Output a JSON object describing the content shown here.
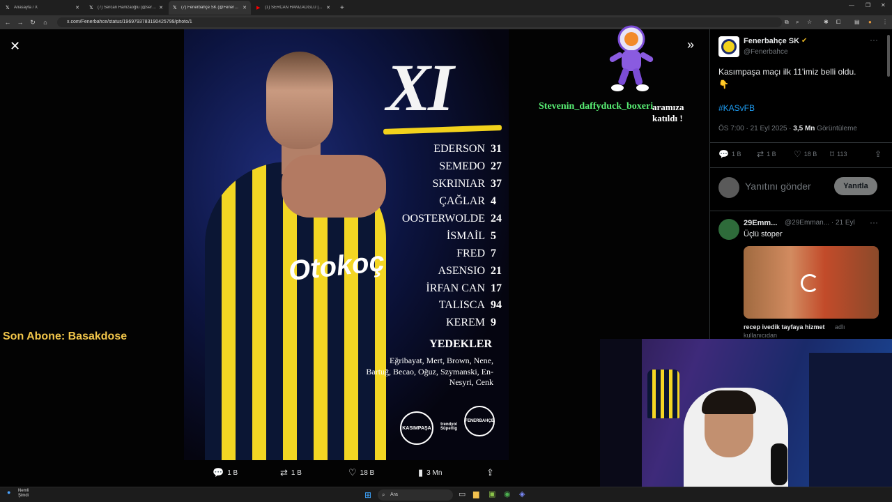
{
  "tabs": [
    {
      "title": "Anasayfa / X",
      "favicon": "x-icon",
      "active": false
    },
    {
      "title": "(7) Sercan Hamzaoğlu (@sercan",
      "favicon": "x-icon",
      "active": false
    },
    {
      "title": "(7) Fenerbahçe SK (@Fenerbah",
      "favicon": "x-icon",
      "active": true
    },
    {
      "title": "(1) SERCAN HAMZAOĞLU | FB",
      "favicon": "youtube-icon",
      "active": false
    }
  ],
  "address": {
    "url": "x.com/Fenerbahce/status/1969793783190425799/photo/1"
  },
  "photo": {
    "sponsor": "Otokoç",
    "title": "XI",
    "lineup": [
      {
        "name": "EDERSON",
        "number": "31"
      },
      {
        "name": "SEMEDO",
        "number": "27"
      },
      {
        "name": "SKRINIAR",
        "number": "37"
      },
      {
        "name": "ÇAĞLAR",
        "number": "4"
      },
      {
        "name": "OOSTERWOLDE",
        "number": "24"
      },
      {
        "name": "İSMAİL",
        "number": "5"
      },
      {
        "name": "FRED",
        "number": "7"
      },
      {
        "name": "ASENSIO",
        "number": "21"
      },
      {
        "name": "İRFAN CAN",
        "number": "17"
      },
      {
        "name": "TALISCA",
        "number": "94"
      },
      {
        "name": "KEREM",
        "number": "9"
      }
    ],
    "subs_title": "YEDEKLER",
    "subs_list": "Eğribayat, Mert, Brown, Nene, Bartuğ, Becao, Oğuz, Szymanski, En-Nesyri, Cenk",
    "logos": {
      "left": "KASIMPAŞA",
      "middle_line1": "trendyol",
      "middle_line2": "Süperlig",
      "right": "FENERBAHÇE"
    }
  },
  "overlay": {
    "username": "Stevenin_daffyduck_boxeri",
    "joined_text": "aramıza katıldı !",
    "son_abone": "Son Abone: Basakdose"
  },
  "photo_actions": {
    "replies": "1 B",
    "reposts": "1 B",
    "likes": "18 B",
    "views": "3 Mn"
  },
  "tweet": {
    "account_name": "Fenerbahçe SK",
    "handle": "@Fenerbahce",
    "text": "Kasımpaşa maçı ilk 11'imiz belli oldu.",
    "emoji": "👇",
    "hashtag": "#KASvFB",
    "time": "ÖS 7:00 · 21 Eyl 2025 · ",
    "views_count": "3,5 Mn",
    "views_label": " Görüntüleme",
    "stats": {
      "replies": "1 B",
      "reposts": "1 B",
      "likes": "18 B",
      "bookmarks": "113"
    },
    "reply_placeholder": "Yanıtını gönder",
    "reply_button": "Yanıtla"
  },
  "reply1": {
    "name": "29Emm...",
    "handle": "@29Emman... · 21 Eyl",
    "text": "Üçlü stoper",
    "caption": "recep ivedik tayfaya hizmet",
    "caption_suffix": "adlı",
    "caption_line2": "kullanıcıdan"
  },
  "taskbar": {
    "weather_line1": "Nemli",
    "weather_line2": "Şimdi",
    "search_placeholder": "Ara"
  },
  "colors": {
    "accent": "#1d9bf0",
    "overlay_green": "#59f075",
    "son_abone": "#f1c54a",
    "fb_yellow": "#f2d21c"
  }
}
